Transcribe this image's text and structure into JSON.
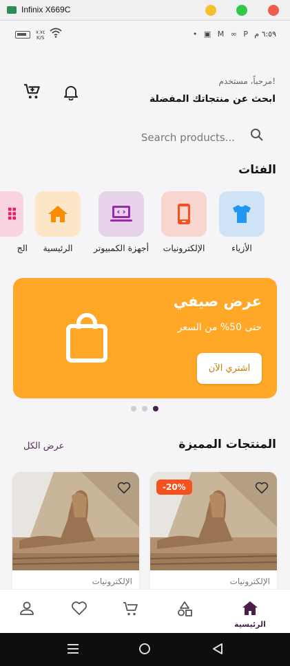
{
  "window": {
    "title": "Infinix X669C"
  },
  "statusbar": {
    "network_speed": "٧.٧٤\nK/S",
    "time": "٦:٥٩ م"
  },
  "header": {
    "greeting": "مرحباً، مستخدم!",
    "subtitle": "ابحث عن منتجاتك المفضلة"
  },
  "search": {
    "placeholder": "Search products..."
  },
  "categories": {
    "title": "الفئات",
    "items": [
      {
        "label": "الأزياء",
        "icon": "shirt-icon",
        "bg": "#cfe3f7",
        "color": "#2196f3"
      },
      {
        "label": "الإلكترونيات",
        "icon": "phone-icon",
        "bg": "#f9d5d0",
        "color": "#f4511e"
      },
      {
        "label": "أجهزة الكمبيوتر",
        "icon": "laptop-icon",
        "bg": "#e6d3ea",
        "color": "#9c27b0"
      },
      {
        "label": "الرئيسية",
        "icon": "home-icon",
        "bg": "#fde6c8",
        "color": "#fb8c00"
      },
      {
        "label": "الج",
        "icon": "grid-icon",
        "bg": "#f9d3dd",
        "color": "#e91e63"
      }
    ]
  },
  "banner": {
    "title": "عرض صيفي",
    "subtitle": "حتى 50% من السعر",
    "button_label": "اشتري الآن",
    "bg": "#ffa726"
  },
  "carousel": {
    "pages": 3,
    "active_page": 3
  },
  "featured": {
    "title": "المنتجات المميزة",
    "view_all": "عرض الكل",
    "products": [
      {
        "category": "الإلكترونيات",
        "badge": "-20%"
      },
      {
        "category": "الإلكترونيات",
        "badge": ""
      }
    ]
  },
  "bottom_nav": {
    "items": [
      {
        "label": "الرئيسية",
        "icon": "home-icon",
        "active": true
      },
      {
        "label": "",
        "icon": "categories-icon"
      },
      {
        "label": "",
        "icon": "cart-icon"
      },
      {
        "label": "",
        "icon": "heart-icon"
      },
      {
        "label": "",
        "icon": "profile-icon"
      }
    ]
  },
  "colors": {
    "accent": "#4a1d4a",
    "background": "#f5f4f7",
    "badge": "#f4511e"
  }
}
